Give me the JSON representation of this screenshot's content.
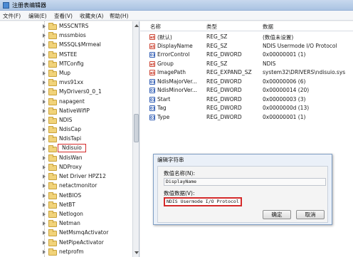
{
  "window": {
    "title": "注册表编辑器"
  },
  "menu": [
    "文件(F)",
    "编辑(E)",
    "查看(V)",
    "收藏夹(A)",
    "帮助(H)"
  ],
  "tree": {
    "items": [
      "MSSCNTRS",
      "mssmbios",
      "MSSQL$Mrmeal",
      "MSTEE",
      "MTConfig",
      "Mup",
      "mvs91xx",
      "MyDrivers0_0_1",
      "napagent",
      "NativeWifiP",
      "NDIS",
      "NdisCap",
      "NdisTapi",
      "Ndisuio",
      "NdisWan",
      "NDProxy",
      "Net Driver HPZ12",
      "netactmonitor",
      "NetBIOS",
      "NetBT",
      "Netlogon",
      "Netman",
      "NetMsmqActivator",
      "NetPipeActivator",
      "netprofm"
    ],
    "selected": "Ndisuio"
  },
  "list": {
    "columns": [
      "名称",
      "类型",
      "数据"
    ],
    "rows": [
      {
        "icon": "string-value-icon",
        "name": "(默认)",
        "type": "REG_SZ",
        "data": "(数值未设置)"
      },
      {
        "icon": "string-value-icon",
        "name": "DisplayName",
        "type": "REG_SZ",
        "data": "NDIS Usermode I/O Protocol"
      },
      {
        "icon": "dword-value-icon",
        "name": "ErrorControl",
        "type": "REG_DWORD",
        "data": "0x00000001 (1)"
      },
      {
        "icon": "string-value-icon",
        "name": "Group",
        "type": "REG_SZ",
        "data": "NDIS"
      },
      {
        "icon": "string-value-icon",
        "name": "ImagePath",
        "type": "REG_EXPAND_SZ",
        "data": "system32\\DRIVERS\\ndisuio.sys"
      },
      {
        "icon": "dword-value-icon",
        "name": "NdisMajorVer...",
        "type": "REG_DWORD",
        "data": "0x00000006 (6)"
      },
      {
        "icon": "dword-value-icon",
        "name": "NdisMinorVer...",
        "type": "REG_DWORD",
        "data": "0x00000014 (20)"
      },
      {
        "icon": "dword-value-icon",
        "name": "Start",
        "type": "REG_DWORD",
        "data": "0x00000003 (3)"
      },
      {
        "icon": "dword-value-icon",
        "name": "Tag",
        "type": "REG_DWORD",
        "data": "0x0000000d (13)"
      },
      {
        "icon": "dword-value-icon",
        "name": "Type",
        "type": "REG_DWORD",
        "data": "0x00000001 (1)"
      }
    ]
  },
  "dialog": {
    "title": "编辑字符串",
    "name_label": "数值名称(N):",
    "name_value": "DisplayName",
    "data_label": "数值数据(V):",
    "data_value": "NDIS Usermode I/O Protocol",
    "ok_label": "确定",
    "cancel_label": "取消"
  }
}
